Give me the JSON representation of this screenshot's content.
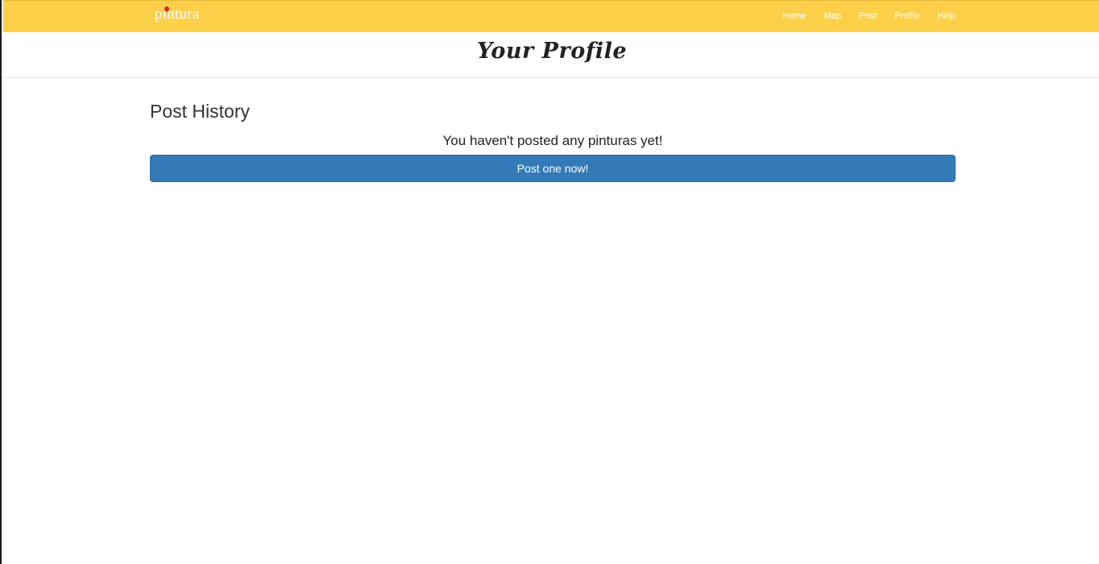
{
  "navbar": {
    "brand": "pintura",
    "items": [
      {
        "label": "Home"
      },
      {
        "label": "Map"
      },
      {
        "label": "Post"
      },
      {
        "label": "Profile"
      },
      {
        "label": "Help"
      }
    ]
  },
  "header": {
    "title": "Your Profile"
  },
  "main": {
    "section_title": "Post History",
    "empty_message": "You haven't posted any pinturas yet!",
    "cta_label": "Post one now!"
  },
  "colors": {
    "navbar_bg": "#fdd04a",
    "button_bg": "#337ab7",
    "brand_pin": "#e02020"
  }
}
